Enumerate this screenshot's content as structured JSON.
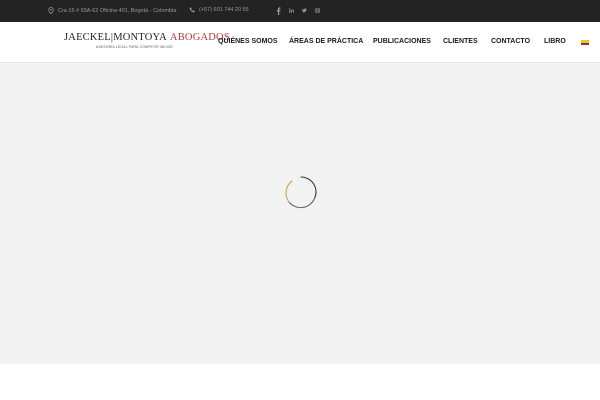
{
  "topbar": {
    "address": "Cra 15 # 93A-62 Oficina 401, Bogotá - Colombia",
    "phone": "(+57) 601 744 20 55",
    "social": [
      "facebook-icon",
      "linkedin-icon",
      "twitter-icon",
      "instagram-icon"
    ]
  },
  "logo": {
    "name": "JAECKEL|MONTOYA",
    "accent": "ABOGADOS",
    "tagline": "ASESORÍA LEGAL PARA COMPETIR MEJOR"
  },
  "nav": {
    "items": [
      {
        "label": "QUIÉNES SOMOS"
      },
      {
        "label": "ÁREAS DE PRÁCTICA"
      },
      {
        "label": "PUBLICACIONES"
      },
      {
        "label": "CLIENTES"
      },
      {
        "label": "CONTACTO"
      },
      {
        "label": "LIBRO"
      }
    ],
    "language_flag": "colombia-flag-icon"
  },
  "colors": {
    "topbar_bg": "#232323",
    "accent": "#b33a3a",
    "content_bg": "#f2f2f2"
  }
}
